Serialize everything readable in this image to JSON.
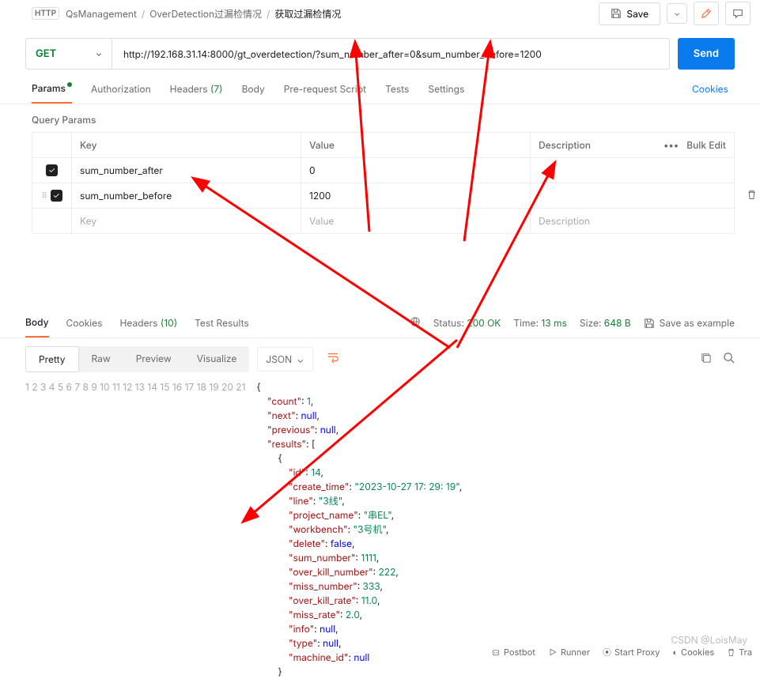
{
  "breadcrumb": {
    "root": "QsManagement",
    "mid": "OverDetection过漏检情况",
    "cur": "获取过漏检情况"
  },
  "top": {
    "save": "Save"
  },
  "request": {
    "method": "GET",
    "url": "http://192.168.31.14:8000/gt_overdetection/?sum_number_after=0&sum_number_before=1200",
    "send": "Send"
  },
  "reqTabs": {
    "params": "Params",
    "auth": "Authorization",
    "headers": "Headers",
    "headersCount": "(7)",
    "body": "Body",
    "prereq": "Pre-request Script",
    "tests": "Tests",
    "settings": "Settings",
    "cookies": "Cookies"
  },
  "queryParams": {
    "title": "Query Params",
    "head": {
      "key": "Key",
      "value": "Value",
      "desc": "Description",
      "bulk": "Bulk Edit"
    },
    "rows": [
      {
        "key": "sum_number_after",
        "value": "0"
      },
      {
        "key": "sum_number_before",
        "value": "1200"
      }
    ],
    "placeholder": {
      "key": "Key",
      "value": "Value",
      "desc": "Description"
    }
  },
  "respTabs": {
    "body": "Body",
    "cookies": "Cookies",
    "headers": "Headers",
    "headersCount": "(10)",
    "tests": "Test Results"
  },
  "status": {
    "statusLabel": "Status:",
    "statusVal": "200 OK",
    "timeLabel": "Time:",
    "timeVal": "13 ms",
    "sizeLabel": "Size:",
    "sizeVal": "648 B",
    "saveExample": "Save as example"
  },
  "view": {
    "pretty": "Pretty",
    "raw": "Raw",
    "preview": "Preview",
    "visualize": "Visualize",
    "format": "JSON"
  },
  "responseBody": {
    "count": 1,
    "next": null,
    "previous": null,
    "results": [
      {
        "id": 14,
        "create_time": "2023-10-27 17:29:19",
        "line": "3线",
        "project_name": "串EL",
        "workbench": "3号机",
        "delete": false,
        "sum_number": 1111,
        "over_kill_number": 222,
        "miss_number": 333,
        "over_kill_rate": 11.0,
        "miss_rate": 2.0,
        "info": null,
        "type": null,
        "machine_id": null
      }
    ]
  },
  "codeLines": [
    "{",
    "    \"count\": 1,",
    "    \"next\": null,",
    "    \"previous\": null,",
    "    \"results\": [",
    "        {",
    "            \"id\": 14,",
    "            \"create_time\": \"2023-10-27 17:29:19\",",
    "            \"line\": \"3线\",",
    "            \"project_name\": \"串EL\",",
    "            \"workbench\": \"3号机\",",
    "            \"delete\": false,",
    "            \"sum_number\": 1111,",
    "            \"over_kill_number\": 222,",
    "            \"miss_number\": 333,",
    "            \"over_kill_rate\": 11.0,",
    "            \"miss_rate\": 2.0,",
    "            \"info\": null,",
    "            \"type\": null,",
    "            \"machine_id\": null",
    "        }"
  ],
  "footer": {
    "postbot": "Postbot",
    "runner": "Runner",
    "startProxy": "Start Proxy",
    "cookies": "Cookies",
    "trash": "Tra"
  },
  "watermark": "CSDN @LoisMay"
}
